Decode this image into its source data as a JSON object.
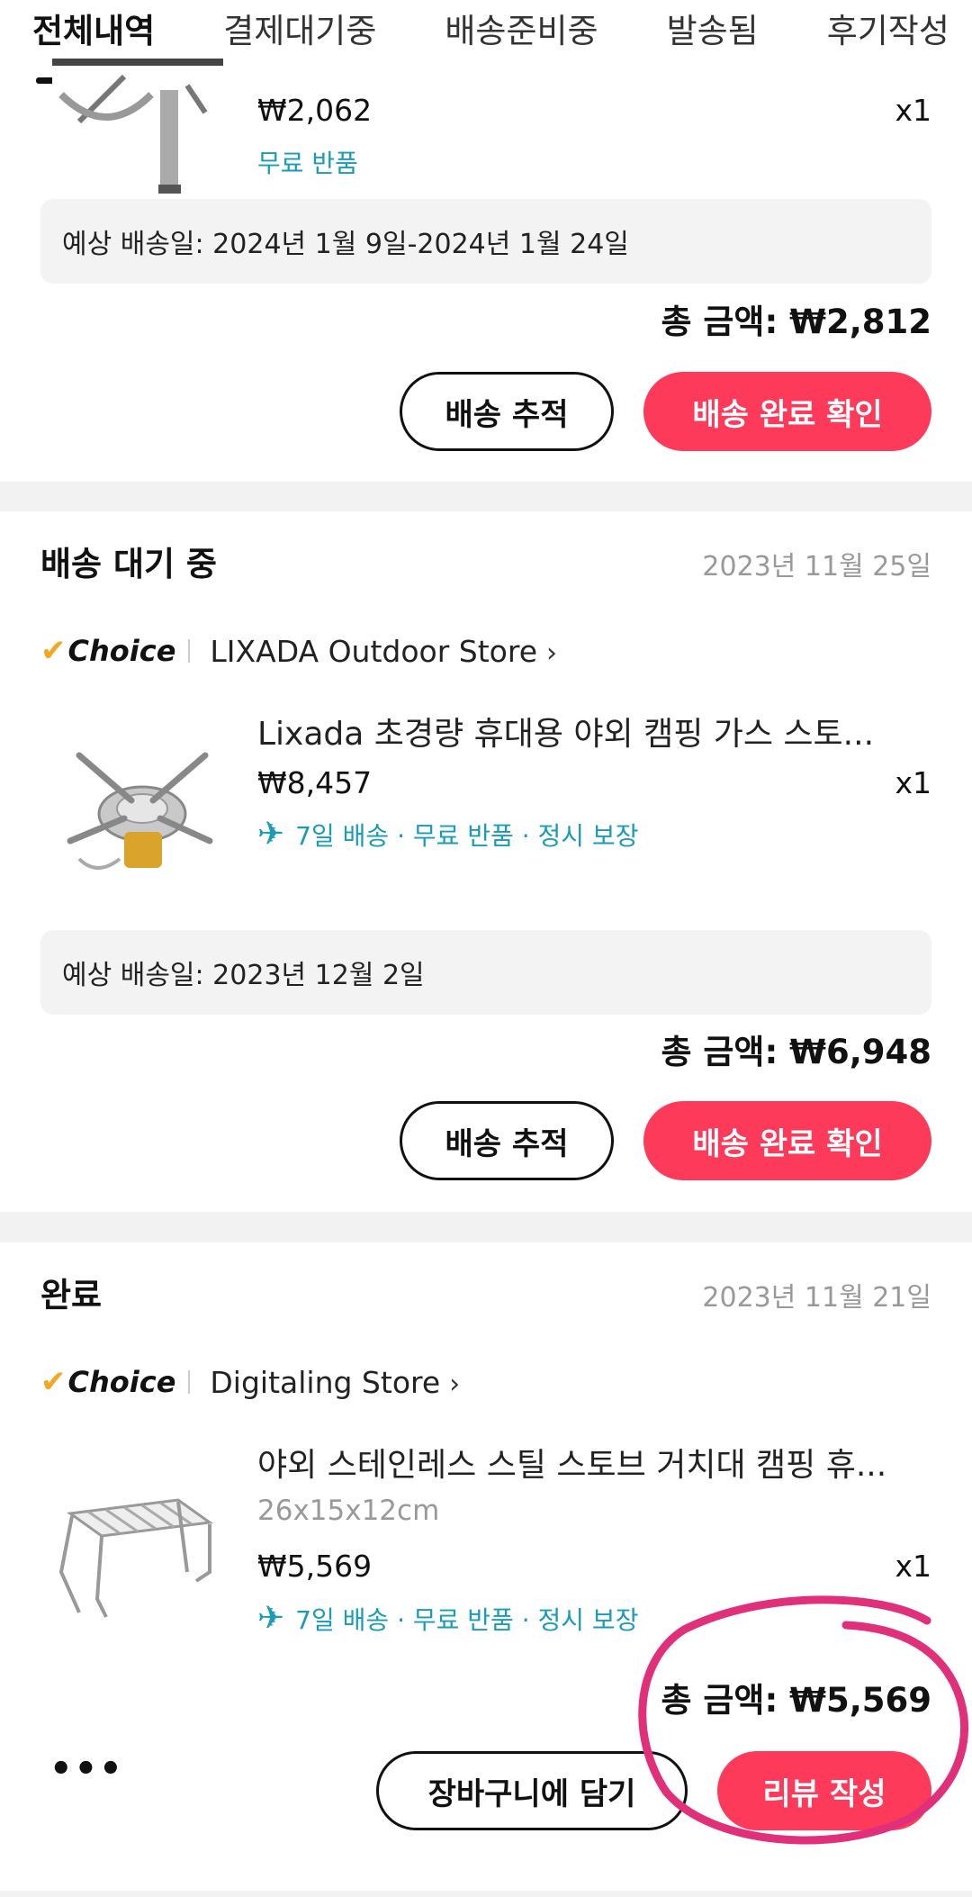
{
  "tabs": [
    "전체내역",
    "결제대기중",
    "배송준비중",
    "발송됨",
    "후기작성"
  ],
  "order1": {
    "price": "₩2,062",
    "free_return": "무료 반품",
    "qty": "x1",
    "eta": "예상 배송일: 2024년 1월 9일-2024년 1월 24일",
    "total": "총 금액: ₩2,812",
    "track_btn": "배송 추적",
    "confirm_btn": "배송 완료 확인"
  },
  "order2": {
    "status": "배송 대기 중",
    "date": "2023년 11월 25일",
    "choice": "Choice",
    "store": "LIXADA Outdoor Store",
    "title": "Lixada 초경량 휴대용 야외 캠핑 가스 스토...",
    "price": "₩8,457",
    "qty": "x1",
    "benefits": "7일 배송 · 무료 반품 · 정시 보장",
    "eta": "예상 배송일: 2023년 12월 2일",
    "total": "총 금액: ₩6,948",
    "track_btn": "배송 추적",
    "confirm_btn": "배송 완료 확인"
  },
  "order3": {
    "status": "완료",
    "date": "2023년 11월 21일",
    "choice": "Choice",
    "store": "Digitaling Store",
    "title": "야외 스테인레스 스틸 스토브 거치대 캠핑 휴...",
    "variant": "26x15x12cm",
    "price": "₩5,569",
    "qty": "x1",
    "benefits": "7일 배송 · 무료 반품 · 정시 보장",
    "total": "총 금액: ₩5,569",
    "more": "•••",
    "cart_btn": "장바구니에 담기",
    "review_btn": "리뷰 작성"
  },
  "icons": {
    "check": "✔",
    "chevron": "›",
    "plane": "✈"
  },
  "colors": {
    "accent": "#fe3a5b",
    "benefit": "#1a9bb8",
    "choice_check": "#f5a623",
    "annotation": "#e0307a"
  }
}
